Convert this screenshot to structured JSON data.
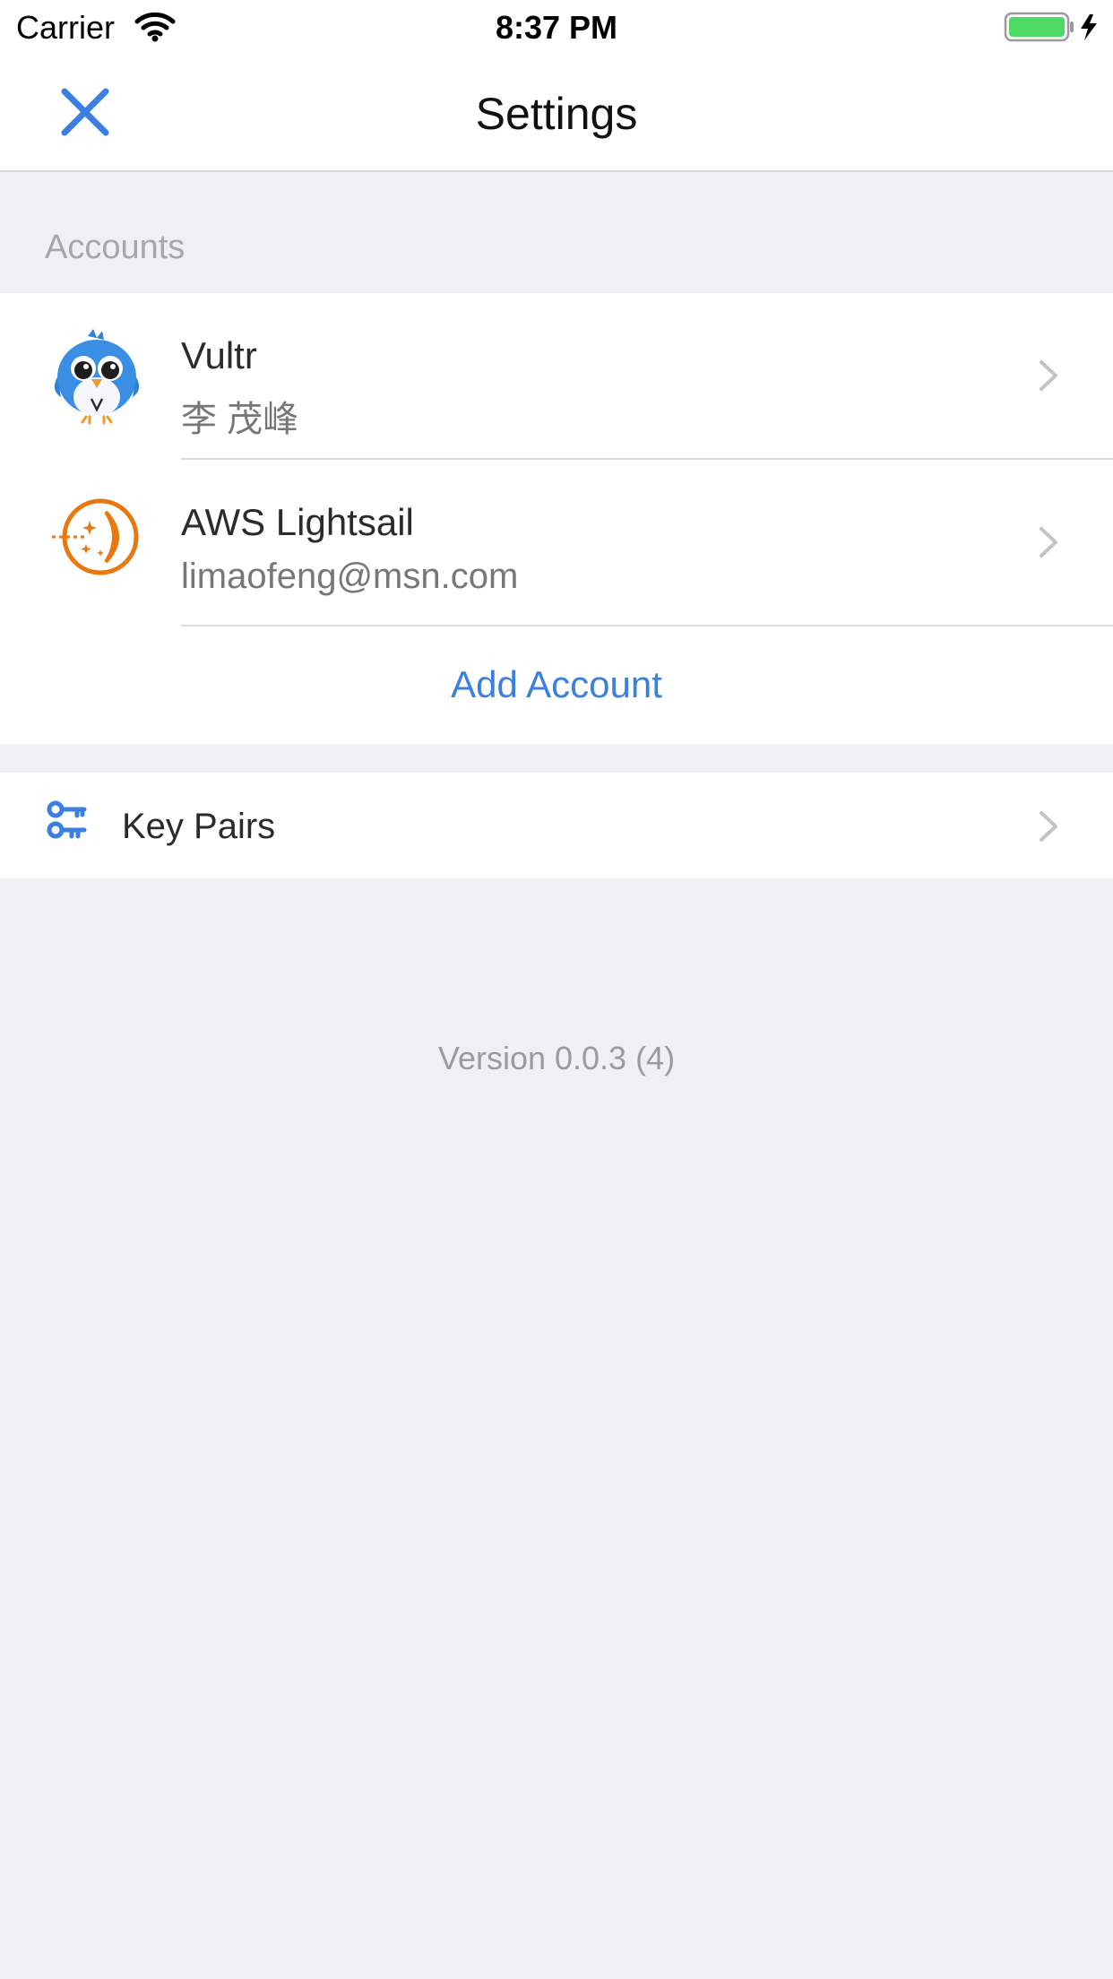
{
  "status_bar": {
    "carrier": "Carrier",
    "time": "8:37 PM",
    "battery_color": "#4cd964",
    "wifi_icon": "wifi-icon",
    "charging_icon": "bolt-icon"
  },
  "nav": {
    "title": "Settings",
    "close_icon": "close-icon",
    "accent": "#3b7fe0"
  },
  "accounts": {
    "header": "Accounts",
    "items": [
      {
        "name": "Vultr",
        "subtitle": "李 茂峰",
        "icon": "vultr-bird-icon"
      },
      {
        "name": "AWS Lightsail",
        "subtitle": "limaofeng@msn.com",
        "icon": "lightsail-icon"
      }
    ],
    "add_label": "Add Account"
  },
  "key_pairs": {
    "label": "Key Pairs",
    "icon": "key-icon"
  },
  "footer": {
    "version": "Version 0.0.3 (4)"
  }
}
